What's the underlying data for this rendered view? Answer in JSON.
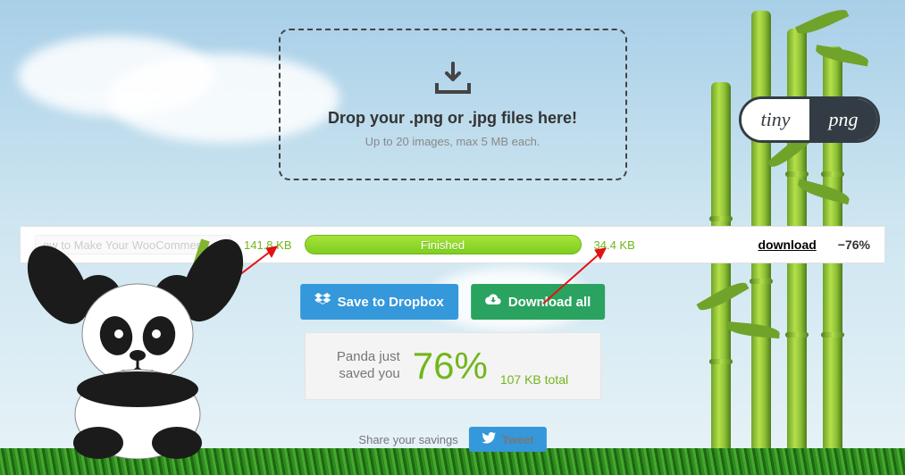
{
  "logo": {
    "left": "tiny",
    "right": "png"
  },
  "dropzone": {
    "title": "Drop your .png or .jpg files here!",
    "subtitle": "Up to 20 images, max 5 MB each."
  },
  "result": {
    "filename": "ow to Make Your WooCommer...",
    "size_before": "141.8 KB",
    "status": "Finished",
    "size_after": "34.4 KB",
    "download_label": "download",
    "savings": "−76%"
  },
  "actions": {
    "dropbox": "Save to Dropbox",
    "download_all": "Download all"
  },
  "summary": {
    "lead": "Panda just\nsaved you",
    "percent": "76%",
    "total": "107 KB total"
  },
  "share": {
    "label": "Share your savings",
    "tweet": "Tweet"
  }
}
